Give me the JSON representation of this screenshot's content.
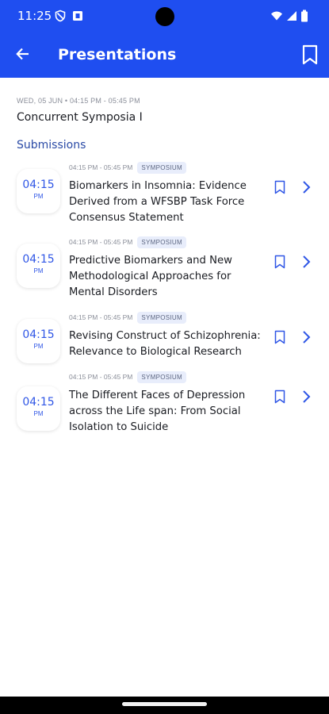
{
  "status_bar": {
    "time": "11:25",
    "icons": [
      "shield-icon",
      "sim-notification-icon",
      "wifi-icon",
      "signal-icon",
      "battery-icon"
    ]
  },
  "app_bar": {
    "title": "Presentations",
    "back_icon": "arrow-left-icon",
    "bookmark_icon": "bookmark-outline-icon"
  },
  "session": {
    "meta": "WED, 05 JUN • 04:15 PM - 05:45 PM",
    "title": "Concurrent Symposia I"
  },
  "section": {
    "title": "Submissions"
  },
  "items": [
    {
      "time": "04:15",
      "ampm": "PM",
      "range": "04:15 PM - 05:45 PM",
      "badge": "SYMPOSIUM",
      "title": "Biomarkers in Insomnia: Evidence Derived from a WFSBP Task Force Consensus Statement"
    },
    {
      "time": "04:15",
      "ampm": "PM",
      "range": "04:15 PM - 05:45 PM",
      "badge": "SYMPOSIUM",
      "title": "Predictive Biomarkers and New Methodological Approaches for Mental Disorders"
    },
    {
      "time": "04:15",
      "ampm": "PM",
      "range": "04:15 PM - 05:45 PM",
      "badge": "SYMPOSIUM",
      "title": "Revising Construct of Schizophrenia: Relevance to Biological Research"
    },
    {
      "time": "04:15",
      "ampm": "PM",
      "range": "04:15 PM - 05:45 PM",
      "badge": "SYMPOSIUM",
      "title": "The Different Faces of Depression across the Life span: From Social Isolation to Suicide"
    }
  ],
  "colors": {
    "primary": "#1f4ef0",
    "accent_text": "#2f56e6",
    "section_title": "#2a4aa6",
    "badge_bg": "#e8edfb"
  }
}
